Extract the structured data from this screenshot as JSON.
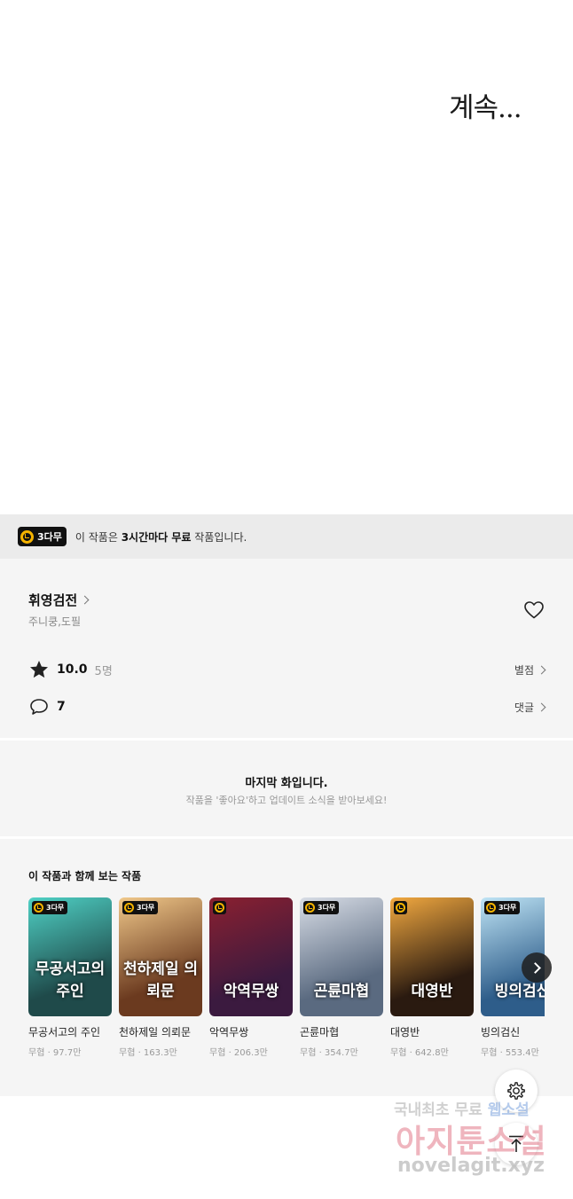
{
  "episode": {
    "continue_text": "계속..."
  },
  "free_banner": {
    "badge_label": "3다무",
    "text_prefix": "이 작품은 ",
    "text_bold": "3시간마다 무료",
    "text_suffix": " 작품입니다."
  },
  "series": {
    "title": "휘영검전",
    "authors": "주니쿵,도필",
    "rating": "10.0",
    "rating_count": "5명",
    "rating_link": "별점",
    "comments": "7",
    "comments_link": "댓글"
  },
  "last_episode": {
    "title": "마지막 화입니다.",
    "subtitle": "작품을 '좋아요'하고 업데이트 소식을 받아보세요!"
  },
  "recommendations": {
    "heading": "이 작품과 함께 보는 작품",
    "items": [
      {
        "title": "무공서고의 주인",
        "meta": "무협 · 97.7만",
        "badge": "3다무",
        "art_text": "무공서고의 주인",
        "colors": [
          "#1f4a4a",
          "#4fd1c5"
        ]
      },
      {
        "title": "천하제일 의뢰문",
        "meta": "무협 · 163.3만",
        "badge": "3다무",
        "art_text": "천하제일 의뢰문",
        "colors": [
          "#6b3a1f",
          "#f0c88a"
        ]
      },
      {
        "title": "악역무쌍",
        "meta": "무협 · 206.3만",
        "badge": "",
        "art_text": "악역무쌍",
        "colors": [
          "#3b1a3f",
          "#8a2030"
        ]
      },
      {
        "title": "곤륜마협",
        "meta": "무협 · 354.7만",
        "badge": "3다무",
        "art_text": "곤륜마협",
        "colors": [
          "#5a6a80",
          "#d8dde6"
        ]
      },
      {
        "title": "대영반",
        "meta": "무협 · 642.8만",
        "badge": "",
        "art_text": "대영반",
        "colors": [
          "#2a1a10",
          "#f2a940"
        ]
      },
      {
        "title": "빙의검신",
        "meta": "무협 · 553.4만",
        "badge": "3다무",
        "art_text": "빙의검신",
        "colors": [
          "#2e5d8a",
          "#bfe4f5"
        ]
      }
    ]
  },
  "watermark": {
    "line1": "국내최초 무료",
    "line1_highlight": "웹소설",
    "line2": "아지툰소설",
    "line3": "novelagit.xyz"
  },
  "colors": {
    "badge_clock": "#f6b400",
    "section_bg": "#f5f5f5",
    "banner_bg": "#ebebeb"
  },
  "icons": [
    "clock-icon",
    "heart-icon",
    "star-icon",
    "comment-icon",
    "chevron-right-icon",
    "settings-icon",
    "arrow-up-icon"
  ]
}
